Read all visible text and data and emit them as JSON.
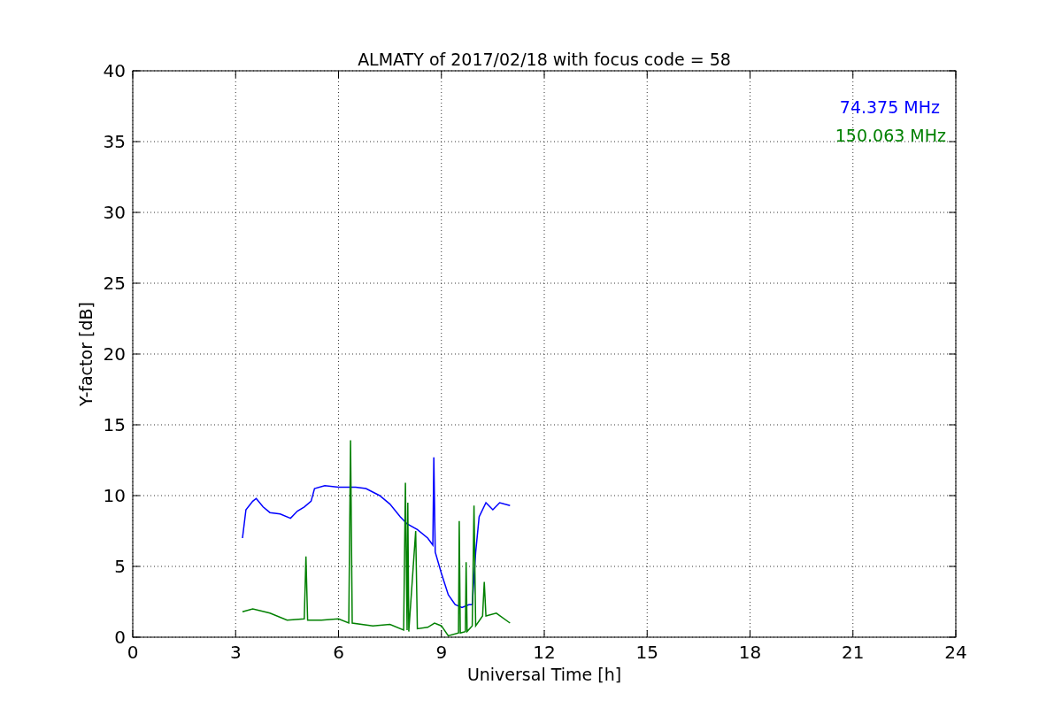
{
  "chart_data": {
    "type": "line",
    "title": "ALMATY of 2017/02/18 with focus code = 58",
    "xlabel": "Universal Time [h]",
    "ylabel": "Y-factor [dB]",
    "xlim": [
      0,
      24
    ],
    "ylim": [
      0,
      40
    ],
    "grid": true,
    "xticks": [
      0,
      3,
      6,
      9,
      12,
      15,
      18,
      21,
      24
    ],
    "yticks": [
      0,
      5,
      10,
      15,
      20,
      25,
      30,
      35,
      40
    ],
    "series": [
      {
        "name": "74.375 MHz",
        "color": "#0000ff",
        "x": [
          3.2,
          3.3,
          3.5,
          3.6,
          3.8,
          4.0,
          4.3,
          4.6,
          4.8,
          5.0,
          5.2,
          5.3,
          5.6,
          6.0,
          6.5,
          6.8,
          7.2,
          7.5,
          7.8,
          8.0,
          8.3,
          8.6,
          8.75,
          8.78,
          8.82,
          9.0,
          9.2,
          9.4,
          9.6,
          9.8,
          9.9,
          10.0,
          10.1,
          10.3,
          10.5,
          10.7,
          11.0
        ],
        "values": [
          7.0,
          9.0,
          9.6,
          9.8,
          9.2,
          8.8,
          8.7,
          8.4,
          8.9,
          9.2,
          9.6,
          10.5,
          10.7,
          10.6,
          10.6,
          10.5,
          10.0,
          9.4,
          8.5,
          8.0,
          7.6,
          7.0,
          6.5,
          12.7,
          6.0,
          4.5,
          3.0,
          2.3,
          2.1,
          2.3,
          2.3,
          6.0,
          8.5,
          9.5,
          9.0,
          9.5,
          9.3
        ]
      },
      {
        "name": "150.063 MHz",
        "color": "#008000",
        "x": [
          3.2,
          3.5,
          4.0,
          4.5,
          5.0,
          5.05,
          5.1,
          5.5,
          6.0,
          6.3,
          6.35,
          6.4,
          7.0,
          7.5,
          7.9,
          7.95,
          8.0,
          8.02,
          8.05,
          8.25,
          8.3,
          8.6,
          8.8,
          9.0,
          9.2,
          9.5,
          9.52,
          9.55,
          9.7,
          9.72,
          9.75,
          9.9,
          9.95,
          10.0,
          10.2,
          10.25,
          10.3,
          10.6,
          11.0
        ],
        "values": [
          1.8,
          2.0,
          1.7,
          1.2,
          1.3,
          5.7,
          1.2,
          1.2,
          1.3,
          1.0,
          13.9,
          1.0,
          0.8,
          0.9,
          0.5,
          10.9,
          0.5,
          9.5,
          0.4,
          7.5,
          0.6,
          0.7,
          1.0,
          0.8,
          0.1,
          0.3,
          8.2,
          0.3,
          0.4,
          5.3,
          0.4,
          0.8,
          9.3,
          0.8,
          1.5,
          3.9,
          1.5,
          1.7,
          1.0
        ]
      }
    ]
  }
}
